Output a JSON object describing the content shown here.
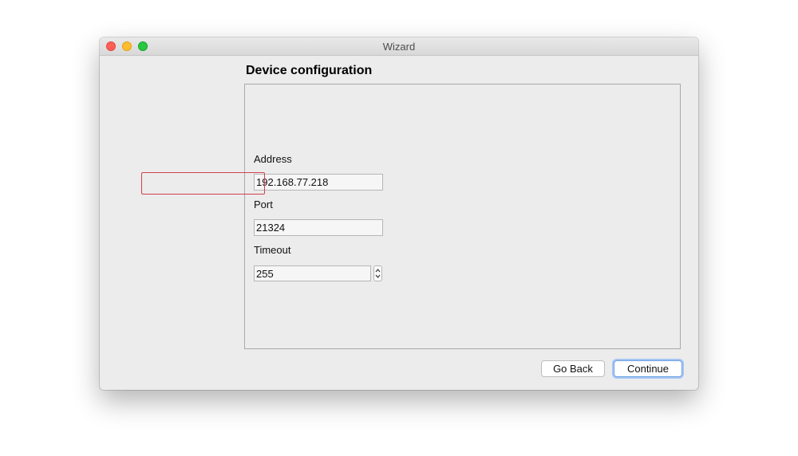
{
  "window": {
    "title": "Wizard"
  },
  "page": {
    "heading": "Device configuration"
  },
  "fields": {
    "address": {
      "label": "Address",
      "value": "192.168.77.218"
    },
    "port": {
      "label": "Port",
      "value": "21324"
    },
    "timeout": {
      "label": "Timeout",
      "value": "255"
    }
  },
  "buttons": {
    "back_label": "Go Back",
    "continue_label": "Continue"
  },
  "icons": {
    "close": "close-traffic-light",
    "minimize": "minimize-traffic-light",
    "maximize": "maximize-traffic-light",
    "stepper": "up-down-stepper"
  },
  "colors": {
    "close": "#ff5f57",
    "minimize": "#ffbd2e",
    "maximize": "#28c840",
    "highlight": "#d0414d",
    "focus_ring": "#a4c6f4"
  }
}
